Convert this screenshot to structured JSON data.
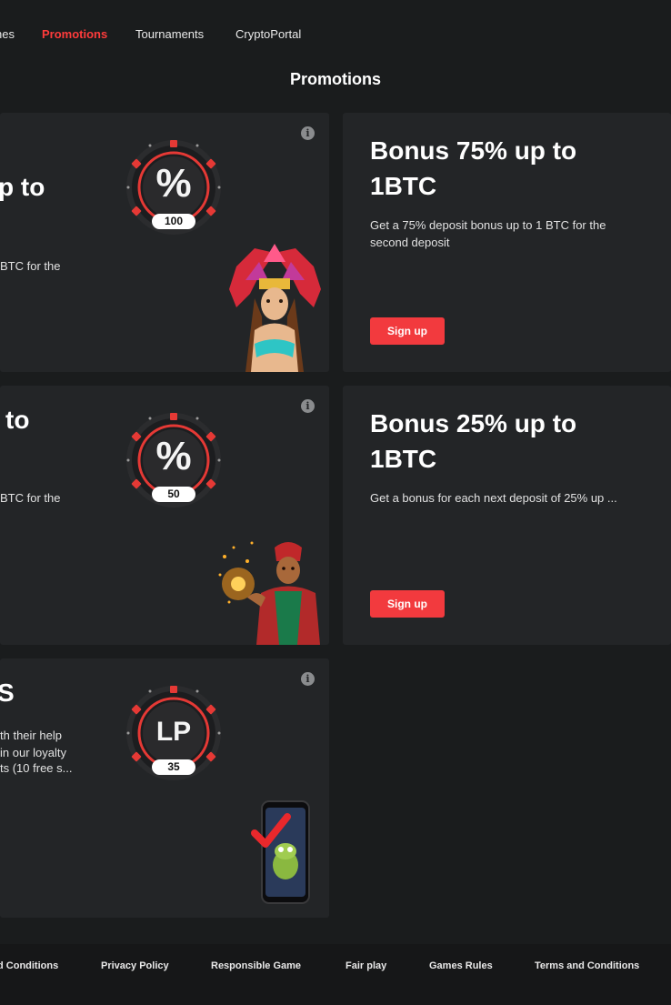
{
  "nav": {
    "items": [
      {
        "label": "nes",
        "active": false
      },
      {
        "label": "Promotions",
        "active": true
      },
      {
        "label": "Tournaments",
        "active": false
      },
      {
        "label": "CryptoPortal",
        "active": false
      }
    ]
  },
  "page_title": "Promotions",
  "cards": [
    {
      "partial_title": "p to",
      "partial_desc": "BTC for the",
      "wheel_symbol": "%",
      "wheel_value": "100",
      "info_icon": "info-icon",
      "character": "aztec-warrior-woman-illustration"
    },
    {
      "title": "Bonus 75% up to 1BTC",
      "desc": "Get a 75% deposit bonus up to 1 BTC for the second deposit",
      "button": "Sign up"
    },
    {
      "partial_title": "to",
      "partial_desc": "BTC for the",
      "wheel_symbol": "%",
      "wheel_value": "50",
      "info_icon": "info-icon",
      "character": "genie-illustration"
    },
    {
      "title": "Bonus 25% up to 1BTC",
      "desc": "Get a bonus for each next deposit of 25% up ...",
      "button": "Sign up"
    },
    {
      "partial_title": "S",
      "partial_desc_lines": [
        "th their help",
        "in our loyalty",
        "ts (10 free s..."
      ],
      "wheel_symbol": "LP",
      "wheel_value": "35",
      "info_icon": "info-icon",
      "character": "phone-frog-checkmark-illustration"
    }
  ],
  "footer": {
    "links": [
      "d Conditions",
      "Privacy Policy",
      "Responsible Game",
      "Fair play",
      "Games Rules",
      "Terms and Conditions"
    ]
  },
  "colors": {
    "background": "#1a1c1d",
    "card": "#232527",
    "accent": "#f23a3e",
    "footer": "#161718"
  }
}
